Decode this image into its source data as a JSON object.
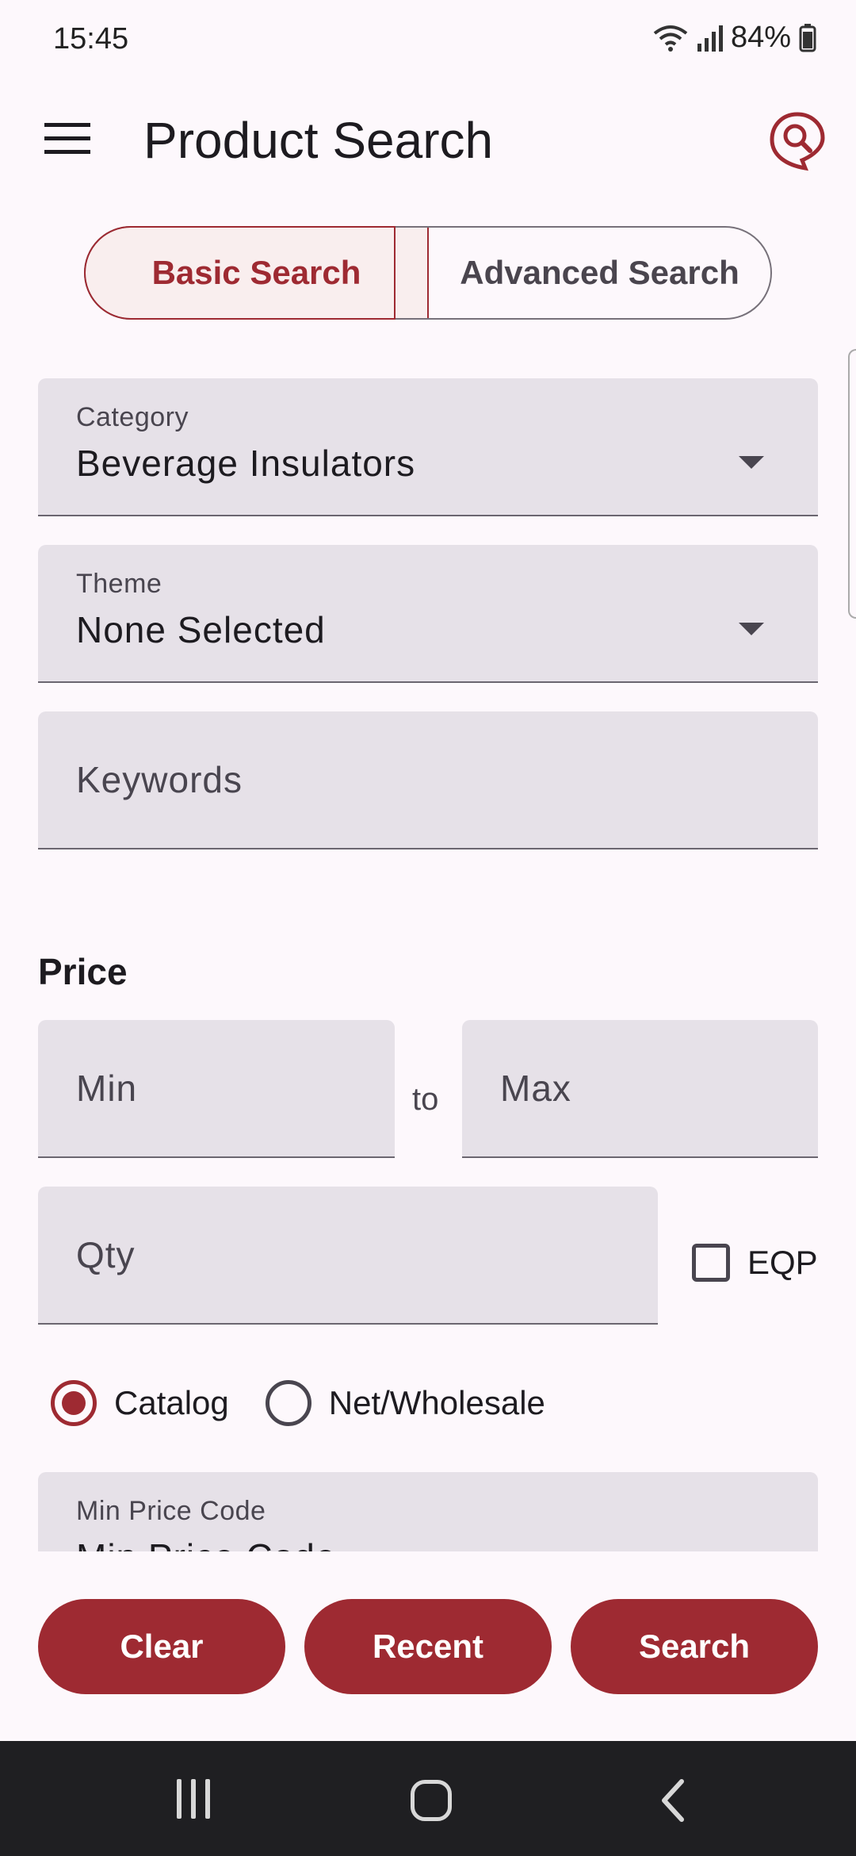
{
  "status": {
    "time": "15:45",
    "battery": "84%"
  },
  "appbar": {
    "title": "Product Search",
    "menu_icon": "hamburger-menu-icon",
    "action_icon": "search-pin-icon"
  },
  "tabs": [
    {
      "label": "Basic Search",
      "selected": true
    },
    {
      "label": "Advanced Search",
      "selected": false
    }
  ],
  "fields": {
    "category": {
      "label": "Category",
      "value": "Beverage Insulators"
    },
    "theme": {
      "label": "Theme",
      "value": "None Selected"
    },
    "keywords": {
      "placeholder": "Keywords"
    },
    "price_label": "Price",
    "min": {
      "placeholder": "Min"
    },
    "to_label": "to",
    "max": {
      "placeholder": "Max"
    },
    "qty": {
      "placeholder": "Qty"
    },
    "eqp": {
      "label": "EQP",
      "checked": false
    },
    "price_type": {
      "options": [
        "Catalog",
        "Net/Wholesale"
      ],
      "selected": "Catalog"
    },
    "min_price_code": {
      "label": "Min Price Code",
      "value": "Min Price Code"
    }
  },
  "actions": {
    "clear": "Clear",
    "recent": "Recent",
    "search": "Search"
  },
  "colors": {
    "accent": "#9e2a32",
    "field_bg": "#e6e1e8",
    "background": "#fdf8fc"
  }
}
